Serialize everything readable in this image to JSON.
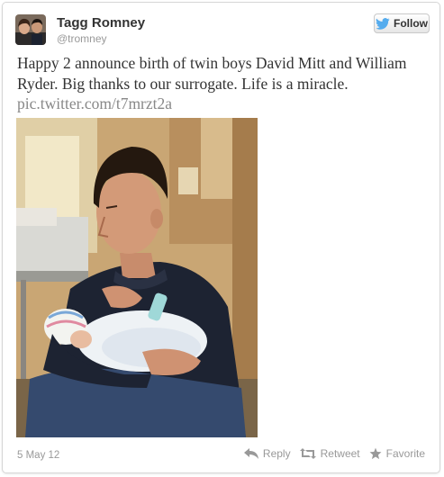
{
  "author": {
    "display_name": "Tagg Romney",
    "screen_name": "@tromney",
    "avatar_icon": "profile-photo"
  },
  "follow_button": {
    "label": "Follow",
    "icon": "twitter-bird-icon",
    "accent": "#55acee"
  },
  "tweet": {
    "text": "Happy 2 announce birth of twin boys David Mitt and William Ryder. Big thanks to our surrogate. Life is a miracle.",
    "link": "pic.twitter.com/t7mrzt2a",
    "photo": "man-holding-newborn-photo"
  },
  "footer": {
    "timestamp": "5 May 12",
    "actions": [
      {
        "label": "Reply",
        "icon": "reply-arrow-icon"
      },
      {
        "label": "Retweet",
        "icon": "retweet-icon"
      },
      {
        "label": "Favorite",
        "icon": "star-icon"
      }
    ]
  }
}
